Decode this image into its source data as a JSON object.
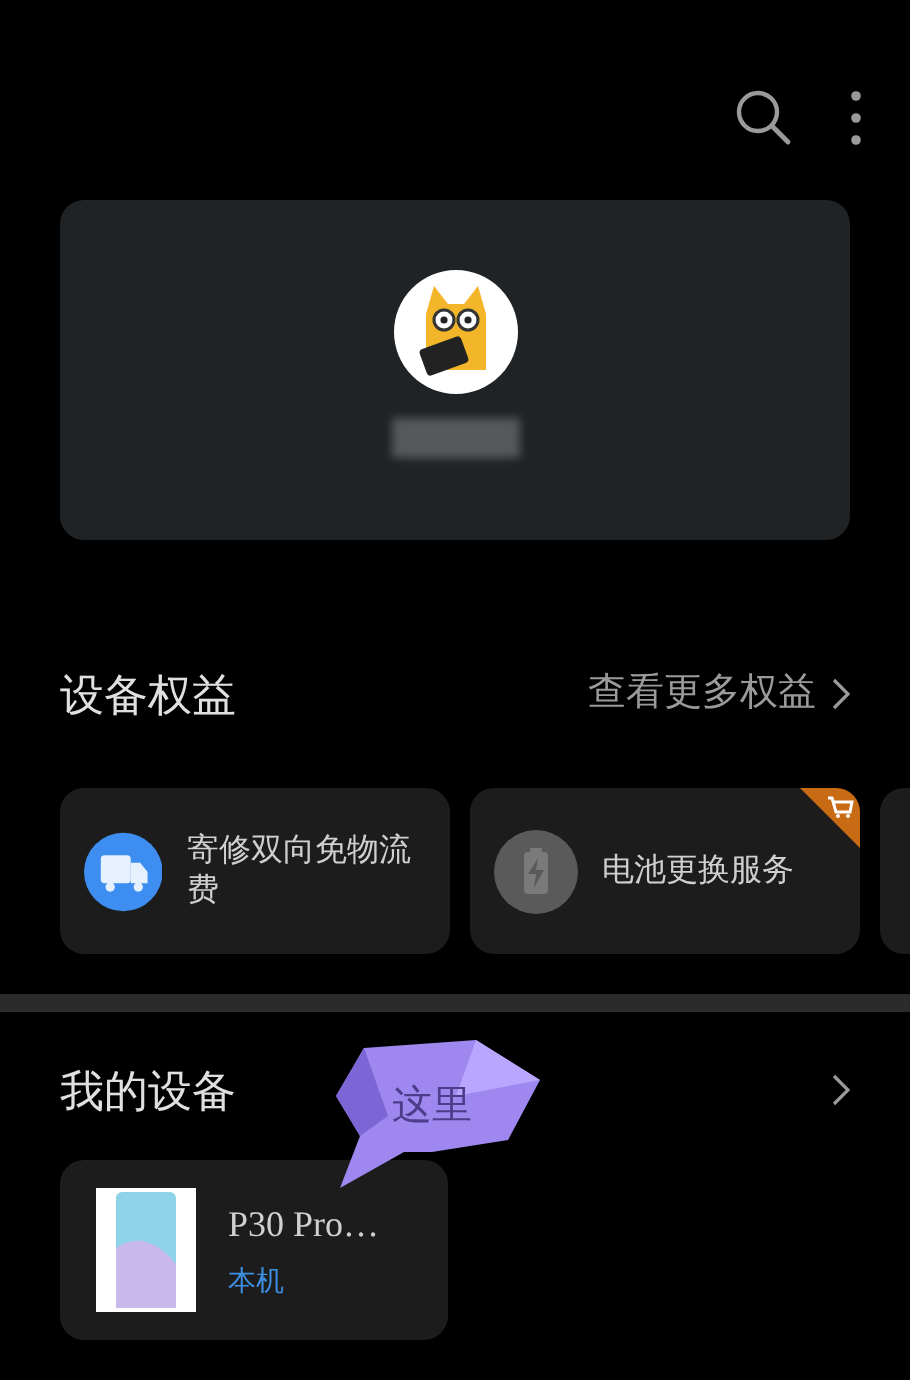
{
  "benefits": {
    "title": "设备权益",
    "more": "查看更多权益",
    "items": [
      {
        "kind": "truck",
        "label": "寄修双向免物流费",
        "badge": false
      },
      {
        "kind": "battery",
        "label": "电池更换服务",
        "badge": true
      }
    ]
  },
  "devices": {
    "title": "我的设备",
    "items": [
      {
        "name": "P30 Pro…",
        "tag": "本机"
      }
    ]
  },
  "callout": {
    "text": "这里"
  }
}
